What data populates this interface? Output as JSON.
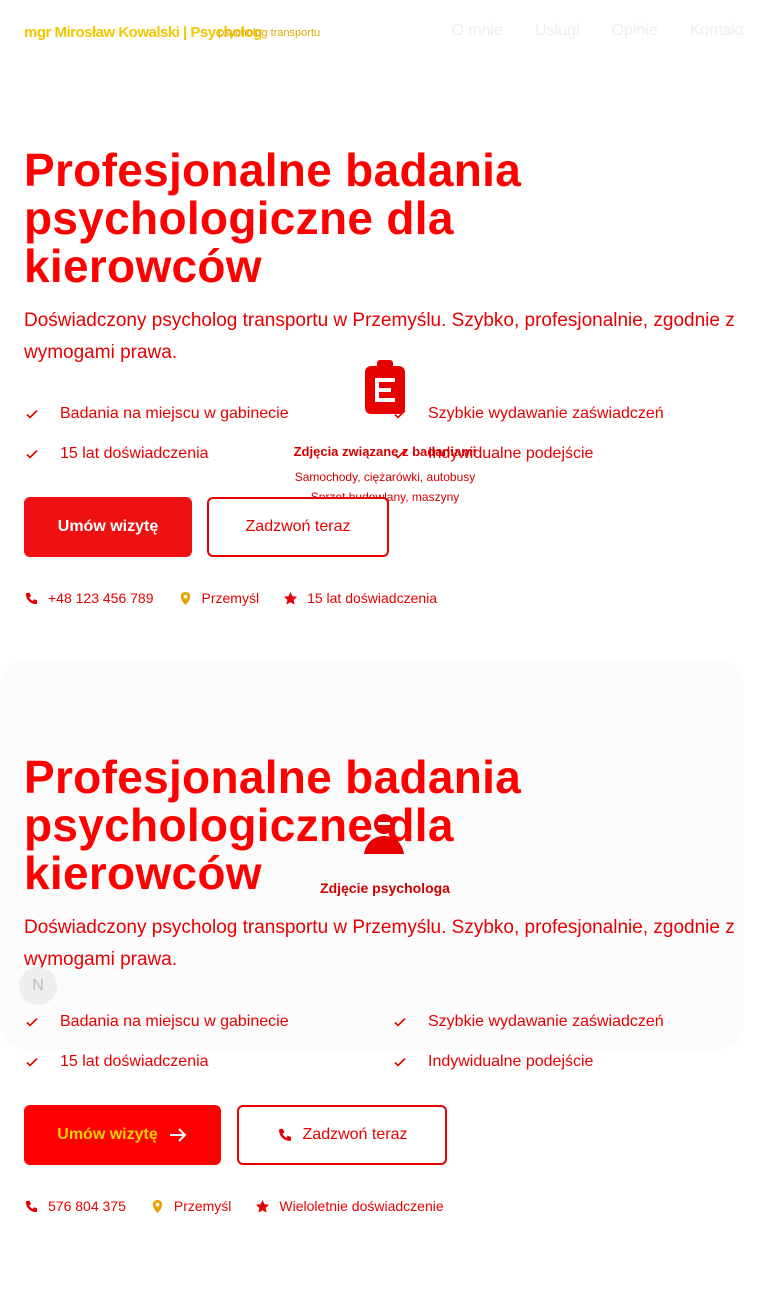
{
  "nav": {
    "brand": "mgr Mirosław Kowalski | Psycholog",
    "brand_sub": "psycholog transportu",
    "links": [
      "O mnie",
      "Usługi",
      "Opinie",
      "Kontakt"
    ]
  },
  "hero1": {
    "title": "Profesjonalne badania psychologiczne dla kierowców",
    "description": "Doświadczony psycholog transportu w Przemyślu. Szybko, profesjonalnie, zgodnie z wymogami prawa.",
    "features": [
      "Badania na miejscu w gabinecie",
      "Szybkie wydawanie zaświadczeń",
      "15 lat doświadczenia",
      "Indywidualne podejście"
    ],
    "primary_button": "Umów wizytę",
    "secondary_button": "Zadzwoń teraz",
    "contacts": {
      "phone": "+48 123 456 789",
      "city": "Przemyśl",
      "experience": "15 lat doświadczenia"
    }
  },
  "overlay": {
    "title": "Zdjęcia związane z badaniami",
    "line1": "Samochody, ciężarówki, autobusy",
    "line2": "Sprzęt budowlany, maszyny"
  },
  "hero2": {
    "title": "Profesjonalne badania psychologiczne dla kierowców",
    "description": "Doświadczony psycholog transportu w Przemyślu. Szybko, profesjonalnie, zgodnie z wymogami prawa.",
    "photo_label": "Zdjęcie psychologa",
    "avatar_letter": "N",
    "features": [
      "Badania na miejscu w gabinecie",
      "Szybkie wydawanie zaświadczeń",
      "15 lat doświadczenia",
      "Indywidualne podejście"
    ],
    "primary_button": "Umów wizytę",
    "secondary_button": "Zadzwoń teraz",
    "contacts": {
      "phone": "576 804 375",
      "city": "Przemyśl",
      "experience": "Wieloletnie doświadczenie"
    }
  },
  "colors": {
    "accent": "#ff0000",
    "text": "#e60000",
    "brand": "#f2c600"
  },
  "icons": {
    "check": "check-icon",
    "phone": "phone-icon",
    "location": "location-pin-icon",
    "star": "star-icon",
    "arrow": "arrow-right-icon",
    "clipboard": "clipboard-icon",
    "person": "person-icon"
  }
}
